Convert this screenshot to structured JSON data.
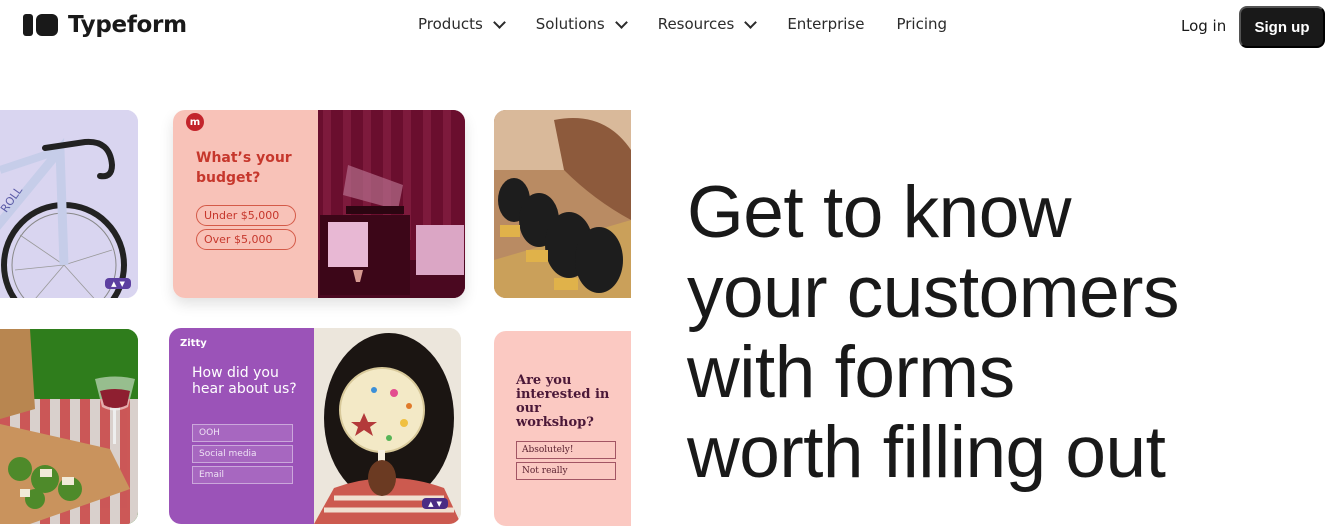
{
  "header": {
    "brand": "Typeform",
    "nav": [
      {
        "label": "Products",
        "has_dropdown": true
      },
      {
        "label": "Solutions",
        "has_dropdown": true
      },
      {
        "label": "Resources",
        "has_dropdown": true
      },
      {
        "label": "Enterprise",
        "has_dropdown": false
      },
      {
        "label": "Pricing",
        "has_dropdown": false
      }
    ],
    "login": "Log in",
    "signup": "Sign up"
  },
  "cards": {
    "budget": {
      "brand_letter": "m",
      "question": "What’s your budget?",
      "options": [
        "Under $5,000",
        "Over $5,000"
      ]
    },
    "zitty": {
      "brand": "Zitty",
      "question": "How did you hear about us?",
      "options": [
        "OOH",
        "Social media",
        "Email"
      ]
    },
    "workshop": {
      "question": "Are you interested in our workshop?",
      "options": [
        "Absolutely!",
        "Not really"
      ]
    }
  },
  "hero": {
    "lines": [
      "Get to know",
      "your customers",
      "with forms",
      "worth filling out"
    ]
  },
  "colors": {
    "brand_dark": "#191919",
    "budget_pink": "#f8c2b8",
    "budget_maroon": "#6c0f2f",
    "zitty_purple": "#9b53b8",
    "workshop_pink": "#fbc9c2"
  }
}
